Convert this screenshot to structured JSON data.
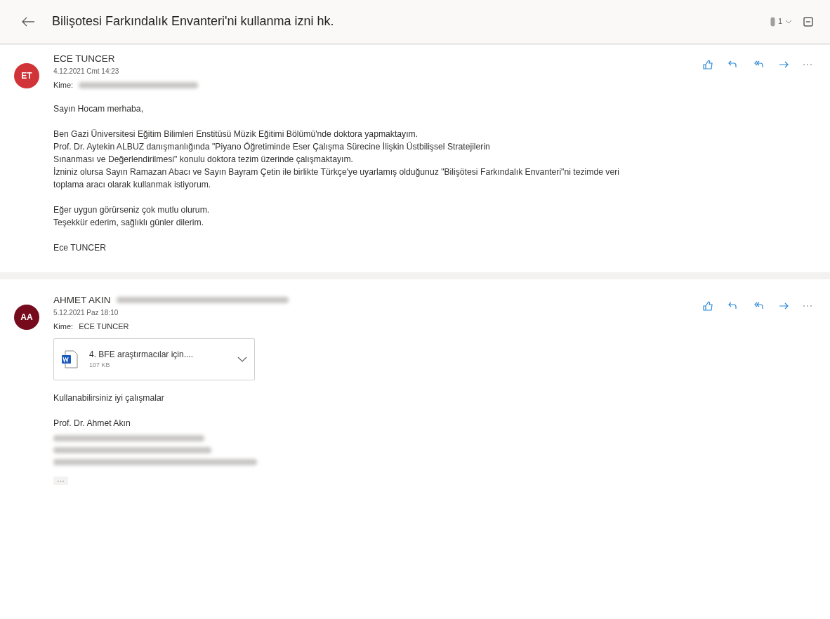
{
  "header": {
    "title": "Bilişotesi Farkındalık Envanteri'ni kullanma izni hk.",
    "attachment_count": "1"
  },
  "messages": [
    {
      "initials": "ET",
      "color": "#d13438",
      "sender": "ECE TUNCER",
      "date": "4.12.2021 Cmt 14:23",
      "to_label": "Kime:",
      "to": {
        "kind": "redacted"
      },
      "paragraphs": [
        [
          "Sayın Hocam merhaba,"
        ],
        [
          "Ben Gazi Üniversitesi Eğitim Bilimleri Enstitüsü Müzik Eğitimi Bölümü'nde doktora yapmaktayım.",
          "Prof. Dr. Aytekin ALBUZ danışmanlığında \"Piyano Öğretiminde Eser Çalışma Sürecine İlişkin Üstbilişsel Stratejilerin",
          "Sınanması ve Değerlendirilmesi\" konulu doktora tezim üzerinde çalışmaktayım.",
          "İzniniz olursa Sayın Ramazan Abacı ve Sayın Bayram Çetin ile birlikte Türkçe'ye uyarlamış olduğunuz \"Bilişötesi Farkındalık Envanteri\"ni tezimde veri",
          "toplama aracı olarak kullanmak istiyorum."
        ],
        [
          "Eğer uygun görürseniz çok mutlu olurum.",
          "Teşekkür ederim, sağlıklı günler dilerim."
        ],
        [
          "Ece TUNCER"
        ]
      ]
    },
    {
      "initials": "AA",
      "color": "#750b1c",
      "sender": "AHMET AKIN",
      "sender_address": {
        "kind": "redacted"
      },
      "date": "5.12.2021 Paz 18:10",
      "to_label": "Kime:",
      "to": {
        "kind": "text",
        "text": "ECE TUNCER"
      },
      "attachment": {
        "name": "4. BFE araştırmacılar için....",
        "size": "107 KB"
      },
      "paragraphs": [
        [
          "Kullanabilirsiniz iyi çalışmalar"
        ],
        [
          "Prof. Dr. Ahmet Akın"
        ]
      ],
      "signature_lines": [
        {
          "kind": "redacted"
        },
        {
          "kind": "redacted"
        },
        {
          "kind": "redacted"
        }
      ],
      "show_more": "···"
    }
  ]
}
